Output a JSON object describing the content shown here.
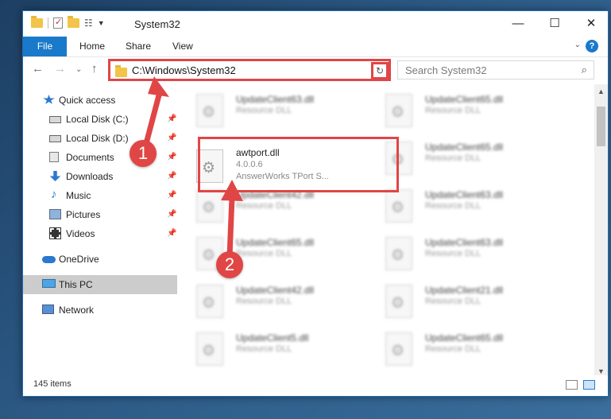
{
  "window": {
    "title": "System32",
    "controls": [
      "—",
      "☐",
      "✕"
    ]
  },
  "ribbon": {
    "tabs": [
      "File",
      "Home",
      "Share",
      "View"
    ]
  },
  "navigation": {
    "address_path": "C:\\Windows\\System32",
    "search_placeholder": "Search System32"
  },
  "sidebar": {
    "items": [
      {
        "label": "Quick access",
        "icon": "star-icon",
        "pinned": false
      },
      {
        "label": "Local Disk (C:)",
        "icon": "disk-icon",
        "pinned": true
      },
      {
        "label": "Local Disk (D:)",
        "icon": "disk-icon",
        "pinned": true
      },
      {
        "label": "Documents",
        "icon": "documents-icon",
        "pinned": true
      },
      {
        "label": "Downloads",
        "icon": "download-icon",
        "pinned": true
      },
      {
        "label": "Music",
        "icon": "music-icon",
        "pinned": true
      },
      {
        "label": "Pictures",
        "icon": "pictures-icon",
        "pinned": true
      },
      {
        "label": "Videos",
        "icon": "videos-icon",
        "pinned": true
      },
      {
        "label": "OneDrive",
        "icon": "cloud-icon",
        "pinned": false
      },
      {
        "label": "This PC",
        "icon": "pc-icon",
        "pinned": false,
        "selected": true
      },
      {
        "label": "Network",
        "icon": "network-icon",
        "pinned": false
      }
    ]
  },
  "files": {
    "featured": {
      "name": "awtport.dll",
      "version": "4.0.0.6",
      "description": "AnswerWorks TPort S..."
    },
    "left_column": [
      {
        "name": "UpdateClient63.dll",
        "type": "Resource DLL"
      },
      {
        "name": "UpdateClient42.dll",
        "type": "Resource DLL"
      },
      {
        "name": "UpdateClient65.dll",
        "type": "Resource DLL"
      },
      {
        "name": "UpdateClient42.dll",
        "type": "Resource DLL"
      },
      {
        "name": "UpdateClient5.dll",
        "type": "Resource DLL"
      }
    ],
    "right_column": [
      {
        "name": "UpdateClient65.dll",
        "type": "Resource DLL"
      },
      {
        "name": "UpdateClient65.dll",
        "type": "Resource DLL"
      },
      {
        "name": "UpdateClient63.dll",
        "type": "Resource DLL"
      },
      {
        "name": "UpdateClient63.dll",
        "type": "Resource DLL"
      },
      {
        "name": "UpdateClient21.dll",
        "type": "Resource DLL"
      },
      {
        "name": "UpdateClient65.dll",
        "type": "Resource DLL"
      }
    ]
  },
  "status": {
    "item_count": "145 items"
  },
  "annotations": {
    "step1": "1",
    "step2": "2",
    "color": "#e04646"
  }
}
